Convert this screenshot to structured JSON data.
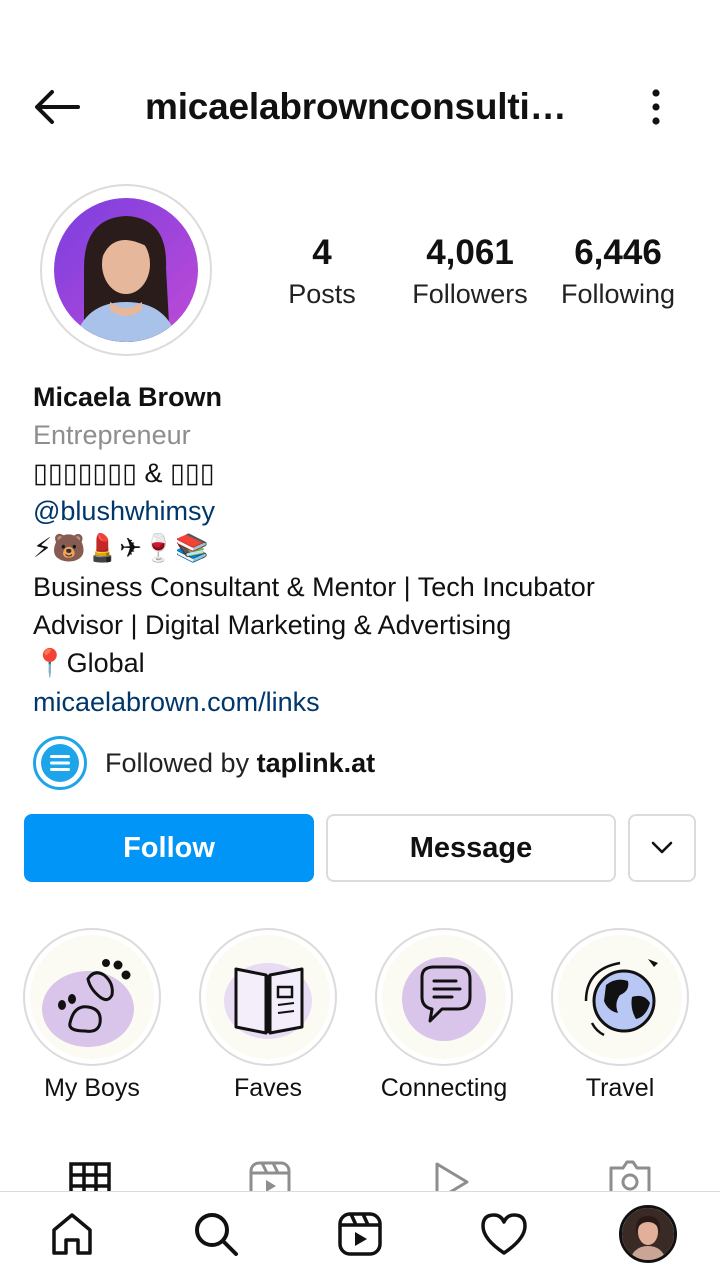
{
  "header": {
    "username": "micaelabrownconsulti…"
  },
  "stats": {
    "posts_count": "4",
    "posts_label": "Posts",
    "followers_count": "4,061",
    "followers_label": "Followers",
    "following_count": "6,446",
    "following_label": "Following"
  },
  "bio": {
    "name": "Micaela Brown",
    "category": "Entrepreneur",
    "tagline": "▯▯▯▯▯▯▯ & ▯▯▯",
    "mention": "@blushwhimsy",
    "emojis": "⚡🐻💄✈🍷📚",
    "description_line1": "Business Consultant & Mentor | Tech Incubator",
    "description_line2": "Advisor | Digital Marketing & Advertising",
    "location_pin": "📍",
    "location": "Global",
    "website": "micaelabrown.com/links"
  },
  "followed_by": {
    "prefix": "Followed by ",
    "account": "taplink.at"
  },
  "actions": {
    "follow_label": "Follow",
    "message_label": "Message"
  },
  "highlights": [
    {
      "label": "My Boys",
      "icon": "paw-print-icon"
    },
    {
      "label": "Faves",
      "icon": "open-book-icon"
    },
    {
      "label": "Connecting",
      "icon": "chat-bubble-icon"
    },
    {
      "label": "Travel",
      "icon": "globe-plane-icon"
    }
  ],
  "tabs": [
    "grid-icon",
    "reels-icon",
    "play-icon",
    "tagged-icon"
  ],
  "bottom_nav": [
    "home-icon",
    "search-icon",
    "reels-icon",
    "heart-icon",
    "profile-avatar"
  ],
  "colors": {
    "accent": "#0095f6",
    "link": "#00376b",
    "muted": "#8e8e8e",
    "highlight_purple": "#d9c4ea"
  }
}
